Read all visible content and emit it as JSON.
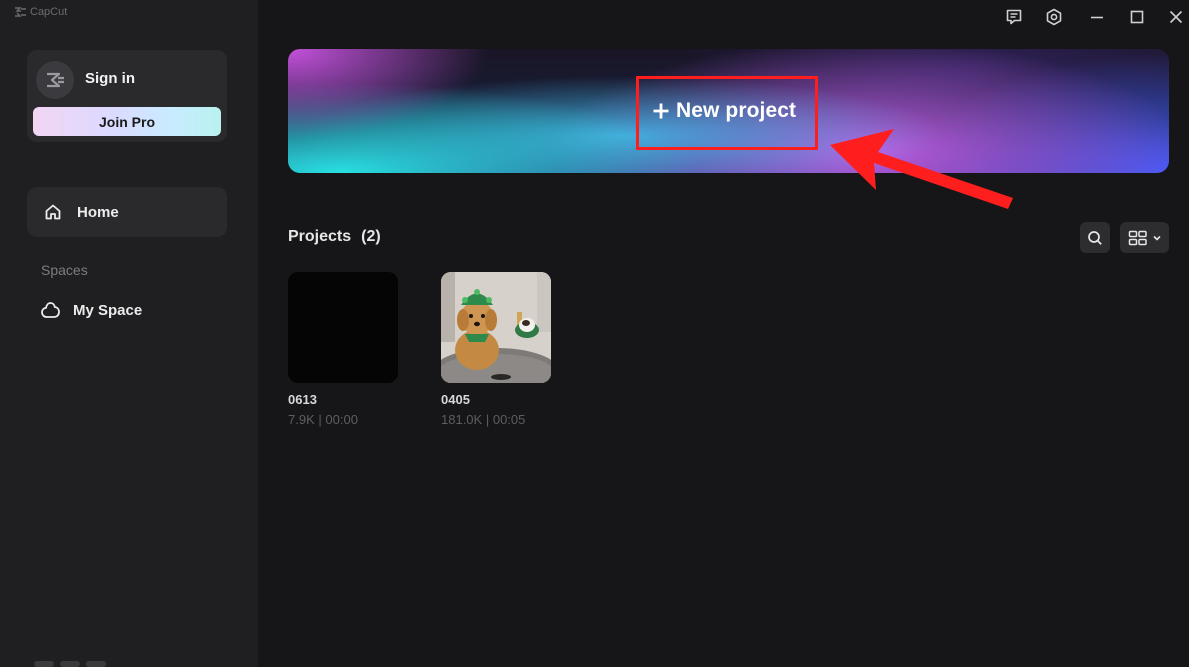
{
  "app": {
    "title": "CapCut"
  },
  "sidebar": {
    "sign_in_label": "Sign in",
    "join_pro_label": "Join Pro",
    "home_label": "Home",
    "spaces_heading": "Spaces",
    "my_space_label": "My Space"
  },
  "banner": {
    "new_project_label": "New project",
    "new_project_icon": "plus-icon"
  },
  "annotation": {
    "highlight_color": "#ff1e1e",
    "arrow_color": "#ff1e1e"
  },
  "projects": {
    "heading": "Projects",
    "count": "(2)",
    "items": [
      {
        "name": "0613",
        "size": "7.9K",
        "separator": "|",
        "duration": "00:00",
        "thumbnail": "black"
      },
      {
        "name": "0405",
        "size": "181.0K",
        "separator": "|",
        "duration": "00:05",
        "thumbnail": "dog-photo"
      }
    ]
  },
  "titlebar_icons": [
    "feedback-icon",
    "settings-icon",
    "minimize-icon",
    "maximize-icon",
    "close-icon"
  ],
  "toolbar_icons": [
    "search-icon",
    "grid-view-icon",
    "chevron-down-icon"
  ],
  "theme": {
    "background": "#161618",
    "sidebar": "#1f1f21",
    "card": "#2a2a2d"
  }
}
